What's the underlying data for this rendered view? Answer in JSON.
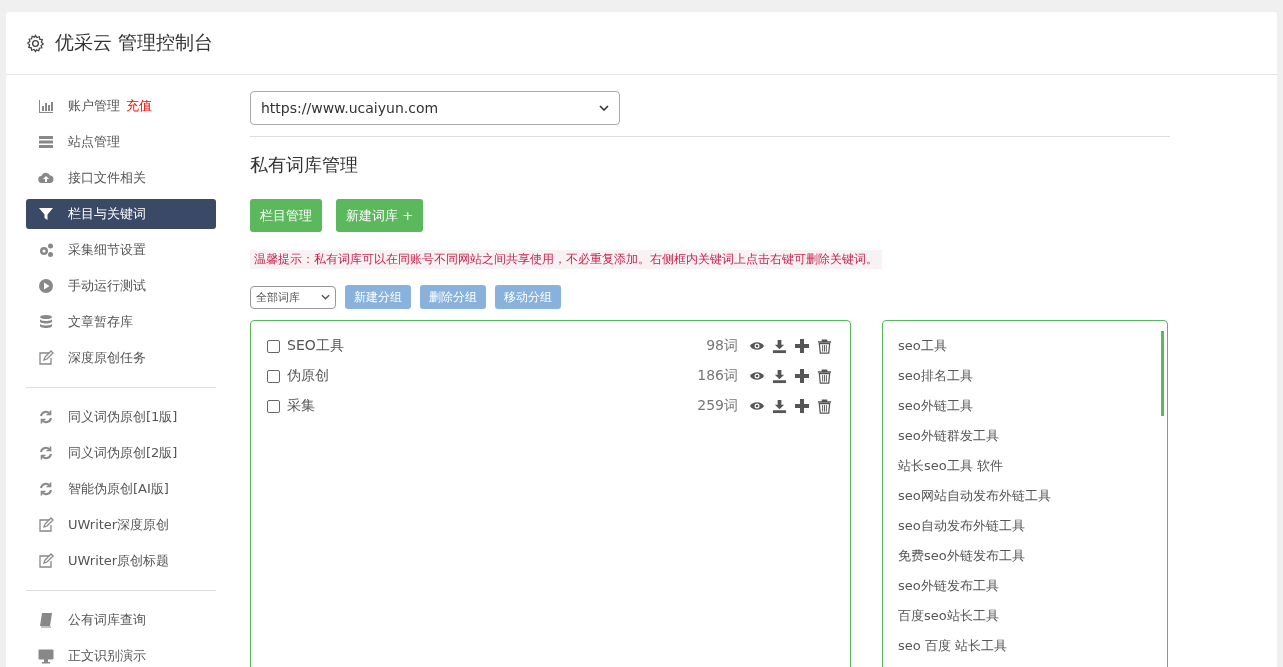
{
  "header": {
    "title": "优采云 管理控制台"
  },
  "sidebar": {
    "groups": [
      {
        "items": [
          {
            "label": "账户管理",
            "badge": "充值",
            "selected": false
          },
          {
            "label": "站点管理",
            "selected": false
          },
          {
            "label": "接口文件相关",
            "selected": false
          },
          {
            "label": "栏目与关键词",
            "selected": true
          },
          {
            "label": "采集细节设置",
            "selected": false
          },
          {
            "label": "手动运行测试",
            "selected": false
          },
          {
            "label": "文章暂存库",
            "selected": false
          },
          {
            "label": "深度原创任务",
            "selected": false
          }
        ]
      },
      {
        "items": [
          {
            "label": "同义词伪原创[1版]",
            "selected": false
          },
          {
            "label": "同义词伪原创[2版]",
            "selected": false
          },
          {
            "label": "智能伪原创[AI版]",
            "selected": false
          },
          {
            "label": "UWriter深度原创",
            "selected": false
          },
          {
            "label": "UWriter原创标题",
            "selected": false
          }
        ]
      },
      {
        "items": [
          {
            "label": "公有词库查询",
            "selected": false
          },
          {
            "label": "正文识别演示",
            "selected": false
          }
        ]
      }
    ]
  },
  "site_select": {
    "value": "https://www.ucaiyun.com"
  },
  "section_title": "私有词库管理",
  "action_buttons": [
    "栏目管理",
    "新建词库 +"
  ],
  "tip": "温馨提示：私有词库可以在同账号不同网站之间共享使用，不必重复添加。右侧框内关键词上点击右键可删除关键词。",
  "group_select": {
    "value": "全部词库"
  },
  "group_buttons": [
    "新建分组",
    "删除分组",
    "移动分组"
  ],
  "word_groups": [
    {
      "name": "SEO工具",
      "count": "98词",
      "checked": false
    },
    {
      "name": "伪原创",
      "count": "186词",
      "checked": false
    },
    {
      "name": "采集",
      "count": "259词",
      "checked": false
    }
  ],
  "keywords": [
    "seo工具",
    "seo排名工具",
    "seo外链工具",
    "seo外链群发工具",
    "站长seo工具 软件",
    "seo网站自动发布外链工具",
    "seo自动发布外链工具",
    "免费seo外链发布工具",
    "seo外链发布工具",
    "百度seo站长工具",
    "seo 百度 站长工具"
  ]
}
